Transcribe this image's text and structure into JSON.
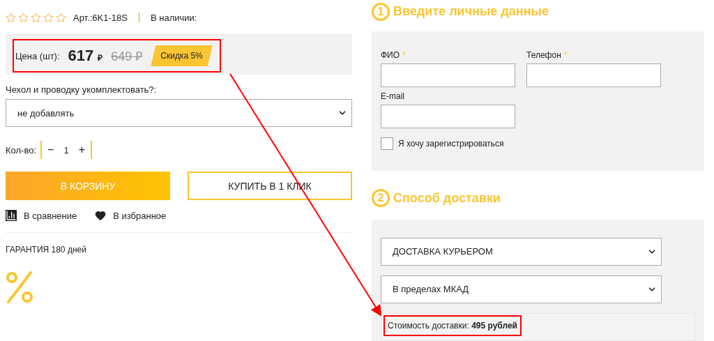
{
  "product": {
    "rating": {
      "stars": 0
    },
    "article": "Арт.:6K1-18S",
    "stock": "В наличии:"
  },
  "price": {
    "label": "Цена (шт):",
    "value": "617",
    "currency": "₽",
    "old_value": "649",
    "old_currency": "₽",
    "discount": "Скидка 5%"
  },
  "option": {
    "label": "Чехол и проводку укомплектовать?:",
    "value": "не добавлять"
  },
  "quantity": {
    "label": "Кол-во:",
    "minus": "−",
    "value": "1",
    "plus": "+"
  },
  "buttons": [
    {
      "kind": "primary",
      "label": "В КОРЗИНУ"
    },
    {
      "kind": "outline",
      "label": "КУПИТЬ В 1 КЛИК"
    }
  ],
  "links": [
    {
      "kind": "compare",
      "label": "В сравнение"
    },
    {
      "kind": "favorite",
      "label": "В избранное"
    }
  ],
  "guarantee": "ГАРАНТИЯ 180 дней",
  "personal": {
    "number": "1",
    "title": "Введите личные данные",
    "fields": [
      {
        "label": "ФИО",
        "required_mark": "*"
      },
      {
        "label": "Телефон",
        "required_mark": "*"
      },
      {
        "label": "E-mail"
      }
    ],
    "register": {
      "label": "Я хочу зарегистрироваться",
      "checked": false
    }
  },
  "delivery": {
    "number": "2",
    "title": "Способ доставки",
    "selects": [
      "ДОСТАВКА КУРЬЕРОМ",
      "В пределах МКАД"
    ],
    "cost": "Стоимость доставки: **495 рублей**"
  }
}
